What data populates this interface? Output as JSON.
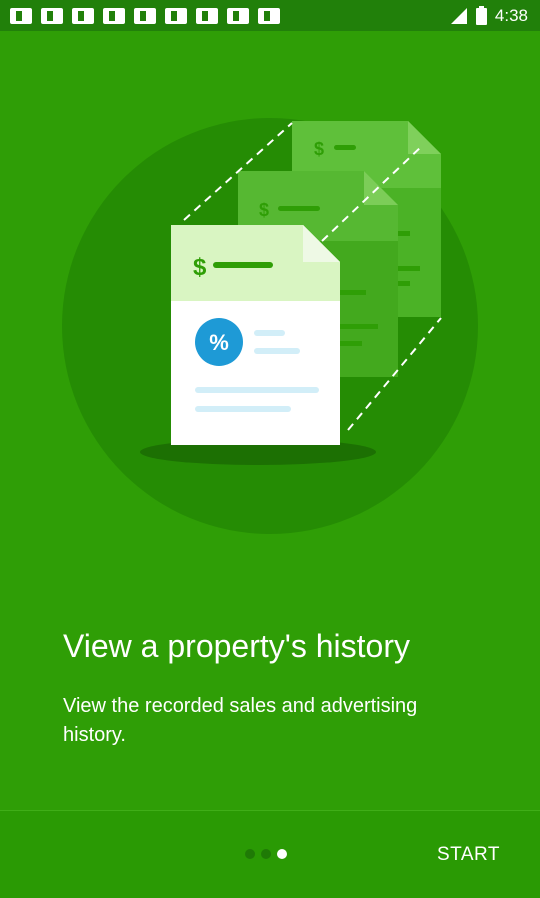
{
  "status_bar": {
    "time": "4:38",
    "notification_icons": [
      "flipboard-icon",
      "flipboard-icon",
      "flipboard-icon",
      "flipboard-icon",
      "flipboard-icon",
      "flipboard-icon",
      "flipboard-icon",
      "flipboard-icon",
      "flipboard-icon"
    ],
    "signal_icon": "signal-icon",
    "battery_icon": "battery-icon"
  },
  "illustration": {
    "doc_symbol": "$",
    "badge_symbol": "%"
  },
  "onboarding": {
    "title": "View a property's history",
    "subtitle": "View the recorded sales and advertising history.",
    "page_count": 3,
    "active_page": 3
  },
  "footer": {
    "start_label": "START"
  },
  "colors": {
    "background": "#2f9e06",
    "status_bar": "#21800a",
    "circle": "#258c04",
    "doc_header": "#d9f5c2",
    "badge": "#1e9ad6"
  }
}
